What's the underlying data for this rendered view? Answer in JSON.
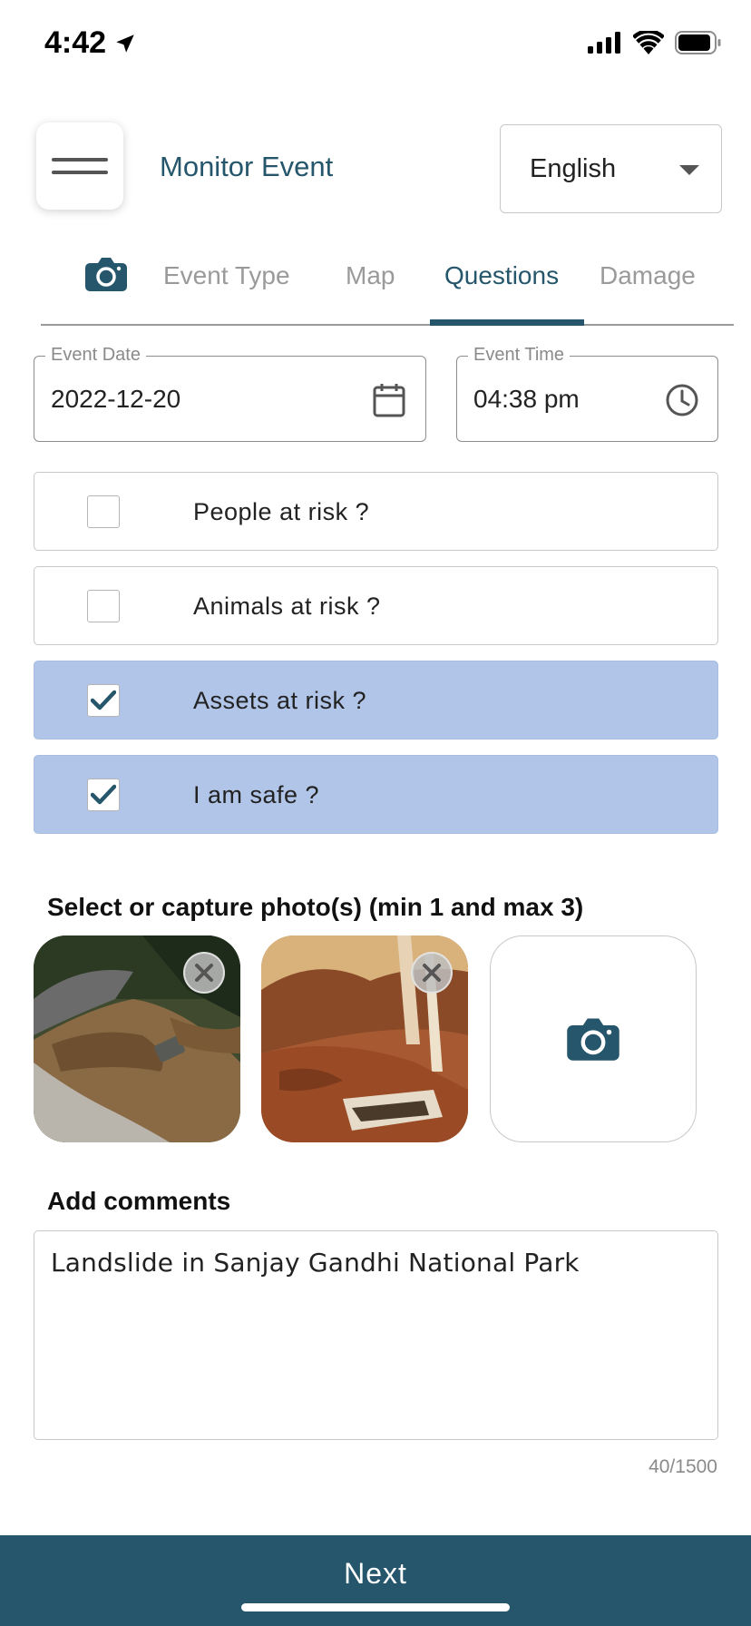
{
  "status_bar": {
    "time": "4:42"
  },
  "header": {
    "title": "Monitor Event",
    "language": "English"
  },
  "tabs": [
    {
      "label": "Event Type"
    },
    {
      "label": "Map"
    },
    {
      "label": "Questions"
    },
    {
      "label": "Damage"
    }
  ],
  "active_tab": "Questions",
  "fields": {
    "event_date": {
      "label": "Event Date",
      "value": "2022-12-20"
    },
    "event_time": {
      "label": "Event Time",
      "value": "04:38 pm"
    }
  },
  "questions": [
    {
      "label": "People at risk ?",
      "checked": false
    },
    {
      "label": "Animals at risk ?",
      "checked": false
    },
    {
      "label": "Assets at risk ?",
      "checked": true
    },
    {
      "label": "I am safe ?",
      "checked": true
    }
  ],
  "photos": {
    "title": "Select or capture photo(s) (min 1 and max 3)"
  },
  "comments": {
    "title": "Add comments",
    "value": "Landslide in Sanjay Gandhi National Park",
    "counter": "40/1500"
  },
  "footer": {
    "next_label": "Next"
  },
  "colors": {
    "primary": "#25566b",
    "checked_row": "#b0c5e8",
    "inactive_tab": "#9a9a9a"
  }
}
